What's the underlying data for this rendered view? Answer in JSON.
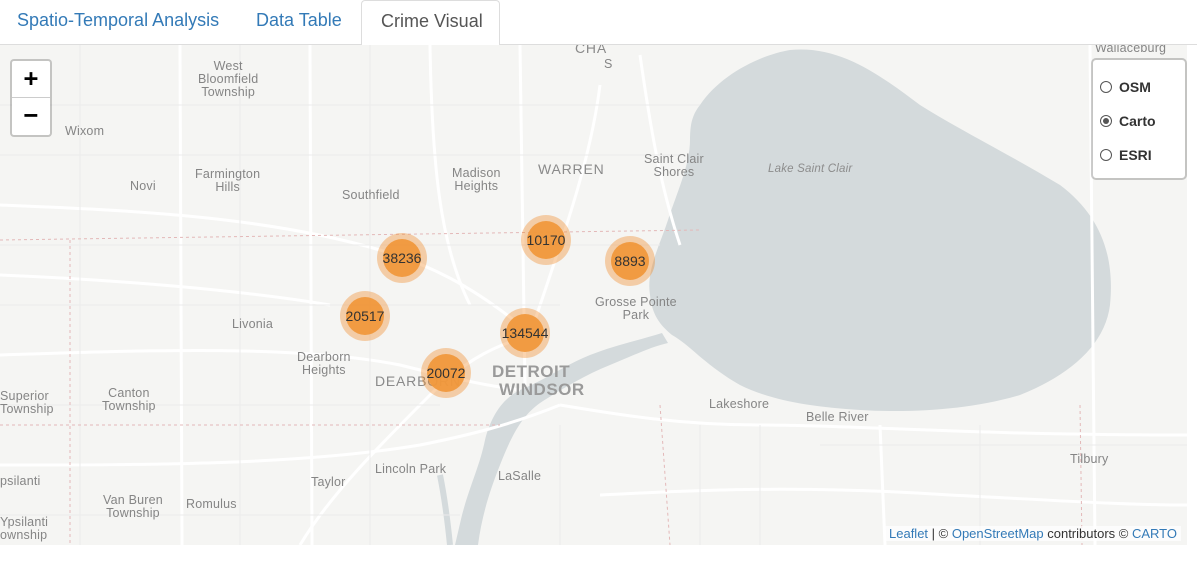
{
  "tabs": [
    {
      "label": "Spatio-Temporal Analysis"
    },
    {
      "label": "Data Table"
    },
    {
      "label": "Crime Visual"
    }
  ],
  "zoom": {
    "in": "+",
    "out": "−"
  },
  "layers": [
    {
      "label": "OSM",
      "selected": false
    },
    {
      "label": "Carto",
      "selected": true
    },
    {
      "label": "ESRI",
      "selected": false
    }
  ],
  "place_labels": {
    "cha": "CHA",
    "s": "S",
    "wallaceburg": "Wallaceburg",
    "west_bloomfield": "West\nBloomfield\nTownship",
    "wixom": "Wixom",
    "novi": "Novi",
    "farmington_hills": "Farmington\nHills",
    "southfield": "Southfield",
    "madison_heights": "Madison\nHeights",
    "warren": "WARREN",
    "saint_clair_shores": "Saint Clair\nShores",
    "lake_saint_clair": "Lake Saint Clair",
    "grosse_pointe_park": "Grosse Pointe\nPark",
    "livonia": "Livonia",
    "dearborn_heights": "Dearborn\nHeights",
    "dearborn": "DEARBORN",
    "detroit": "DETROIT",
    "windsor": "WINDSOR",
    "superior_township": "Superior\nTownship",
    "canton_township": "Canton\nTownship",
    "lakeshore": "Lakeshore",
    "belle_river": "Belle River",
    "lincoln_park": "Lincoln Park",
    "taylor": "Taylor",
    "lasalle": "LaSalle",
    "tilbury": "Tilbury",
    "ypsilanti": "psilanti",
    "van_buren": "Van Buren\nTownship",
    "romulus": "Romulus",
    "ypsilanti_township": "Ypsilanti\nownship"
  },
  "clusters": [
    {
      "count": "38236"
    },
    {
      "count": "10170"
    },
    {
      "count": "8893"
    },
    {
      "count": "20517"
    },
    {
      "count": "134544"
    },
    {
      "count": "20072"
    }
  ],
  "attribution": {
    "leaflet": "Leaflet",
    "sep1": " | © ",
    "osm": "OpenStreetMap",
    "contrib": " contributors © ",
    "carto": "CARTO"
  },
  "colors": {
    "water": "#d4dadc",
    "land": "#f5f5f3",
    "road": "#ffffff",
    "cluster_outer": "#f6c89c",
    "cluster_inner": "#f0983c",
    "link": "#337ab7"
  }
}
